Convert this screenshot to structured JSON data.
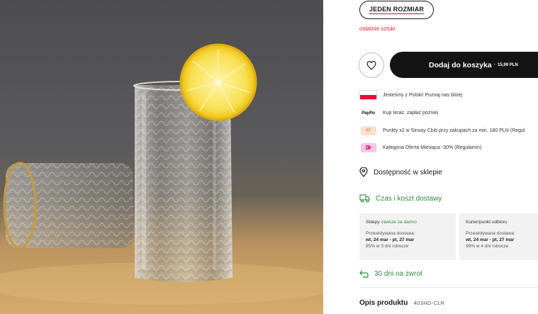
{
  "product_image": {
    "alt_icon": "textured-drinking-glass-with-lemon"
  },
  "size": {
    "label": "JEDEN ROZMIAR"
  },
  "stock": {
    "text": "ostatnie sztuki",
    "color": "#d0283a"
  },
  "cart": {
    "label": "Dodaj do koszyka",
    "separator": "-",
    "price": "15,99 PLN"
  },
  "info": [
    {
      "icon": "polish-flag-icon",
      "text": "Jesteśmy z Polski! Poznaj nas bliżej"
    },
    {
      "icon": "paypo-logo",
      "logo_text": "PayPo",
      "text": "Kup teraz, zapłać później"
    },
    {
      "icon": "points-x2-icon",
      "badge": "x2",
      "text": "Punkty x2 w Sinsay Club przy zakupach za min. 180 PLN (Regul"
    },
    {
      "icon": "offer-tag-icon",
      "text": "Kategoria Oferta Miesiąca -30% (Regulamin)"
    }
  ],
  "availability": {
    "label": "Dostępność w sklepie"
  },
  "delivery": {
    "label": "Czas i koszt dostawy",
    "accent": "#2e8b3e"
  },
  "shipping": [
    {
      "title": "Sklepy",
      "title_note": "zawsze za darmo",
      "eta_label": "Przewidywana dostawa:",
      "eta": "wt, 24 mar - pt, 27 mar",
      "note": "85% w 3 dni robocze"
    },
    {
      "title": "Kurier/punkt odbioru",
      "title_note": "",
      "eta_label": "Przewidywana dostawa:",
      "eta": "wt, 24 mar - pt, 27 mar",
      "note": "99% w 4 dni robocze"
    }
  ],
  "returns": {
    "label": "30 dni na zwrot"
  },
  "description": {
    "title": "Opis produktu",
    "code": "403HD-CLR"
  }
}
